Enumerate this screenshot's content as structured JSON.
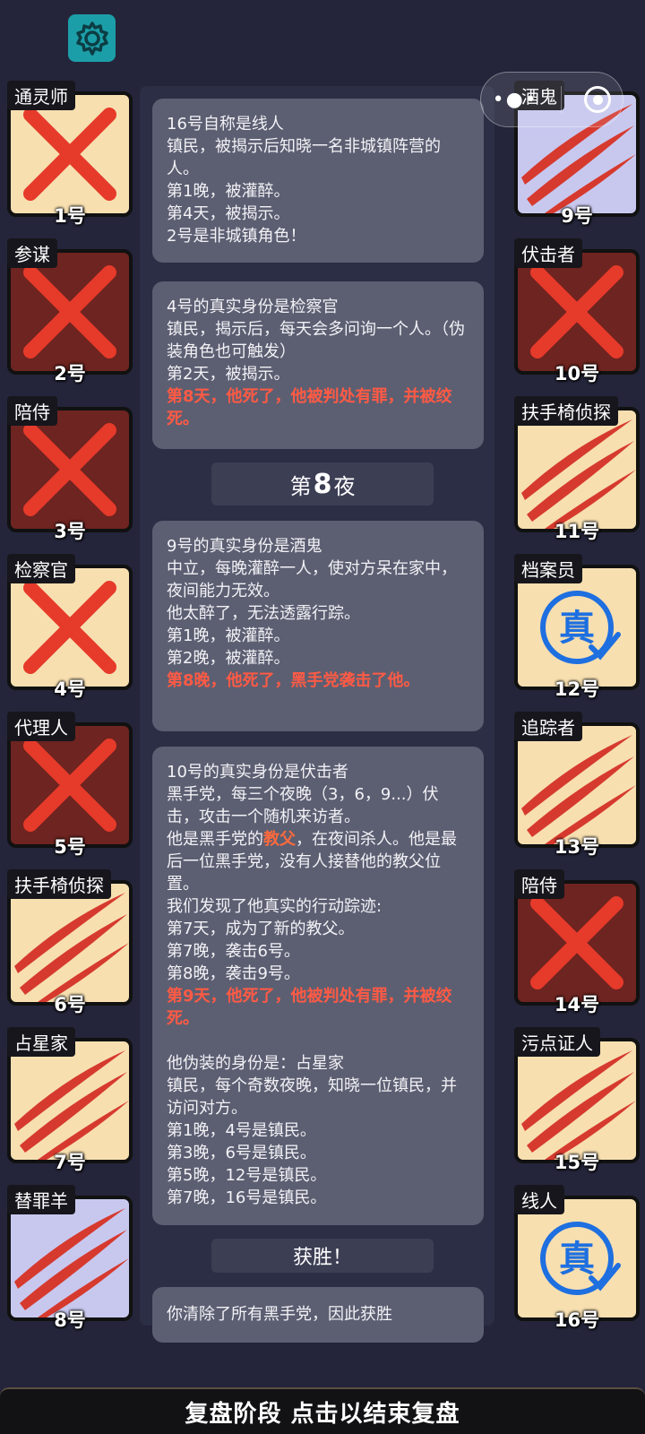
{
  "capsule": {
    "dots": "•●•"
  },
  "players_left": [
    {
      "role": "通灵师",
      "seat": "1号",
      "bg": "beige",
      "mark": "x"
    },
    {
      "role": "参谋",
      "seat": "2号",
      "bg": "dark",
      "mark": "x"
    },
    {
      "role": "陪侍",
      "seat": "3号",
      "bg": "dark",
      "mark": "x"
    },
    {
      "role": "检察官",
      "seat": "4号",
      "bg": "beige",
      "mark": "x"
    },
    {
      "role": "代理人",
      "seat": "5号",
      "bg": "dark",
      "mark": "x"
    },
    {
      "role": "扶手椅侦探",
      "seat": "6号",
      "bg": "beige",
      "mark": "claw"
    },
    {
      "role": "占星家",
      "seat": "7号",
      "bg": "beige",
      "mark": "claw"
    },
    {
      "role": "替罪羊",
      "seat": "8号",
      "bg": "lav",
      "mark": "claw"
    }
  ],
  "players_right": [
    {
      "role": "酒鬼",
      "seat": "9号",
      "bg": "lav",
      "mark": "claw"
    },
    {
      "role": "伏击者",
      "seat": "10号",
      "bg": "dark",
      "mark": "x"
    },
    {
      "role": "扶手椅侦探",
      "seat": "11号",
      "bg": "beige",
      "mark": "claw"
    },
    {
      "role": "档案员",
      "seat": "12号",
      "bg": "beige",
      "mark": "true"
    },
    {
      "role": "追踪者",
      "seat": "13号",
      "bg": "beige",
      "mark": "claw"
    },
    {
      "role": "陪侍",
      "seat": "14号",
      "bg": "dark",
      "mark": "x"
    },
    {
      "role": "污点证人",
      "seat": "15号",
      "bg": "beige",
      "mark": "claw"
    },
    {
      "role": "线人",
      "seat": "16号",
      "bg": "beige",
      "mark": "true"
    }
  ],
  "true_badge": "真",
  "messages": {
    "m1": [
      "16号自称是线人",
      "镇民，被揭示后知晓一名非城镇阵营的人。",
      "第1晚，被灌醉。",
      "第4天，被揭示。",
      "2号是非城镇角色！"
    ],
    "m2": [
      "4号的真实身份是检察官",
      "镇民，揭示后，每天会多问询一个人。（伪装角色也可触发）",
      "第2天，被揭示。"
    ],
    "m2_red": "第8天，他死了，他被判处有罪，并被绞死。",
    "night_pre": "第",
    "night_num": "8",
    "night_post": "夜",
    "m3": [
      "9号的真实身份是酒鬼",
      "中立，每晚灌醉一人，使对方呆在家中，夜间能力无效。",
      "他太醉了，无法透露行踪。",
      "第1晚，被灌醉。",
      "第2晚，被灌醉。"
    ],
    "m3_red": "第8晚，他死了，黑手党袭击了他。",
    "m4_a": [
      "10号的真实身份是伏击者",
      "黑手党，每三个夜晚（3，6，9...）伏击，攻击一个随机来访者。"
    ],
    "m4_b_pre": "他是黑手党的",
    "m4_b_hl": "教父",
    "m4_b_post": "，在夜间杀人。他是最后一位黑手党，没有人接替他的教父位置。",
    "m4_c": [
      "我们发现了他真实的行动踪迹:",
      "第7天，成为了新的教父。",
      "第7晚，袭击6号。",
      "第8晚，袭击9号。"
    ],
    "m4_red": "第9天，他死了，他被判处有罪，并被绞死。",
    "m4_d": [
      "他伪装的身份是：占星家",
      "镇民，每个奇数夜晚，知晓一位镇民，并访问对方。",
      "第1晚，4号是镇民。",
      "第3晚，6号是镇民。",
      "第5晚，12号是镇民。",
      "第7晚，16号是镇民。"
    ],
    "victory": "获胜！",
    "victory_msg": "你清除了所有黑手党，因此获胜"
  },
  "bottom_bar": "复盘阶段 点击以结束复盘",
  "colors": {
    "bg": "#24253a",
    "msg": "#5c5f72",
    "red": "#ff5a44",
    "x": "#e63a2a",
    "claw": "#d63a2e",
    "true": "#1e6fe0"
  }
}
